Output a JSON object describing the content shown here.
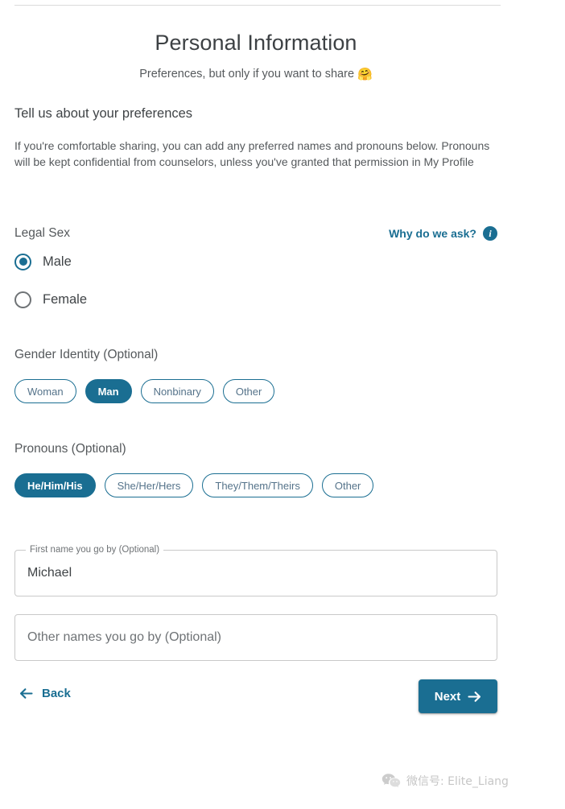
{
  "header": {
    "title": "Personal Information",
    "subtitle": "Preferences, but only if you want to share",
    "subtitle_emoji": "🤗"
  },
  "intro": {
    "heading": "Tell us about your preferences",
    "body": "If you're comfortable sharing, you can add any preferred names and pronouns below. Pronouns will be kept confidential from counselors, unless you've granted that permission in My Profile"
  },
  "legal_sex": {
    "label": "Legal Sex",
    "why_ask_label": "Why do we ask?",
    "why_ask_icon": "info-icon",
    "options": [
      {
        "label": "Male",
        "selected": true
      },
      {
        "label": "Female",
        "selected": false
      }
    ]
  },
  "gender_identity": {
    "label": "Gender Identity (Optional)",
    "options": [
      {
        "label": "Woman",
        "selected": false
      },
      {
        "label": "Man",
        "selected": true
      },
      {
        "label": "Nonbinary",
        "selected": false
      },
      {
        "label": "Other",
        "selected": false
      }
    ]
  },
  "pronouns": {
    "label": "Pronouns (Optional)",
    "options": [
      {
        "label": "He/Him/His",
        "selected": true
      },
      {
        "label": "She/Her/Hers",
        "selected": false
      },
      {
        "label": "They/Them/Theirs",
        "selected": false
      },
      {
        "label": "Other",
        "selected": false
      }
    ]
  },
  "fields": {
    "first_name": {
      "legend": "First name you go by (Optional)",
      "value": "Michael"
    },
    "other_names": {
      "placeholder": "Other names you go by (Optional)",
      "value": ""
    }
  },
  "footer": {
    "back_label": "Back",
    "back_icon": "arrow-left-icon",
    "next_label": "Next",
    "next_icon": "arrow-right-icon"
  },
  "watermark": {
    "icon": "wechat-icon",
    "text": "微信号: Elite_Liang"
  },
  "colors": {
    "accent": "#1a6e92",
    "text_primary": "#3f4346",
    "text_secondary": "#55595c",
    "border": "#c9c9c9"
  }
}
